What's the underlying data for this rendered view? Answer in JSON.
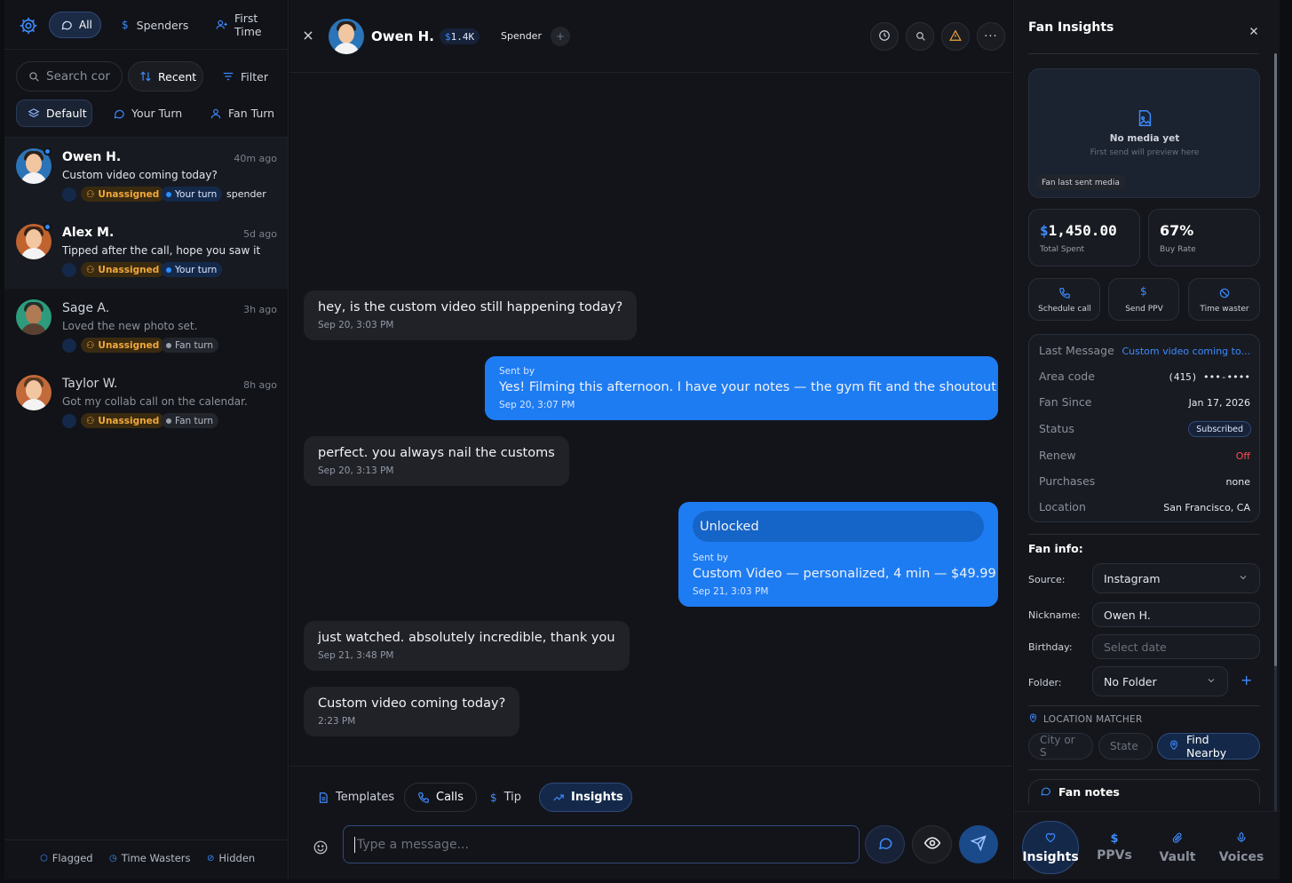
{
  "filters": {
    "all": "All",
    "spenders": "Spenders",
    "first_time": "First Time"
  },
  "search": {
    "placeholder": "Search cor"
  },
  "sort": {
    "recent": "Recent",
    "filter": "Filter"
  },
  "views": {
    "default": "Default",
    "your_turn": "Your Turn",
    "fan_turn": "Fan Turn"
  },
  "conversations": [
    {
      "name": "Owen H.",
      "time": "40m ago",
      "preview": "Custom video coming today?",
      "assign": "Unassigned",
      "turn": "Your turn",
      "extra": "spender"
    },
    {
      "name": "Alex M.",
      "time": "5d ago",
      "preview": "Tipped after the call, hope you saw it",
      "assign": "Unassigned",
      "turn": "Your turn"
    },
    {
      "name": "Sage A.",
      "time": "3h ago",
      "preview": "Loved the new photo set.",
      "assign": "Unassigned",
      "turn": "Fan turn"
    },
    {
      "name": "Taylor W.",
      "time": "8h ago",
      "preview": "Got my collab call on the calendar.",
      "assign": "Unassigned",
      "turn": "Fan turn"
    }
  ],
  "left_footer": {
    "flagged": "Flagged",
    "time_wasters": "Time Wasters",
    "hidden": "Hidden"
  },
  "chat_header": {
    "name": "Owen H.",
    "spent_badge": "1.4K",
    "currency": "$",
    "tag": "Spender",
    "add": "+"
  },
  "messages": [
    {
      "dir": "in",
      "text": "hey, is the custom video still happening today?",
      "time": "Sep 20, 3:03 PM"
    },
    {
      "dir": "out",
      "sent_by": "Sent by",
      "text": "Yes! Filming this afternoon. I have your notes — the gym fit and the shoutout",
      "time": "Sep 20, 3:07 PM"
    },
    {
      "dir": "in",
      "text": "perfect. you always nail the customs",
      "time": "Sep 20, 3:13 PM"
    },
    {
      "dir": "out",
      "unlocked": "Unlocked",
      "sent_by": "Sent by",
      "text": "Custom Video — personalized, 4 min — $49.99",
      "time": "Sep 21, 3:03 PM"
    },
    {
      "dir": "in",
      "text": "just watched. absolutely incredible, thank you",
      "time": "Sep 21, 3:48 PM"
    },
    {
      "dir": "in",
      "text": "Custom video coming today?",
      "time": "2:23 PM"
    }
  ],
  "composer": {
    "templates": "Templates",
    "calls": "Calls",
    "tip": "Tip",
    "tip_symbol": "$",
    "insights": "Insights",
    "placeholder": "Type a message..."
  },
  "insights": {
    "title": "Fan Insights",
    "media": {
      "empty": "No media yet",
      "hint": "First send will preview here",
      "label": "Fan last sent media"
    },
    "total_spent": "1,450.00",
    "total_spent_currency": "$",
    "total_spent_label": "Total Spent",
    "buy_rate": "67%",
    "buy_rate_label": "Buy Rate",
    "actions": {
      "schedule_call": "Schedule call",
      "send_ppv": "Send PPV",
      "time_waster": "Time waster"
    },
    "details": [
      {
        "label": "Last Message",
        "value": "Custom video coming to..."
      },
      {
        "label": "Area code",
        "value": "(415) •••-••••"
      },
      {
        "label": "Fan Since",
        "value": "Jan 17, 2026"
      },
      {
        "label": "Status",
        "value": "Subscribed"
      },
      {
        "label": "Renew",
        "value": "Off"
      },
      {
        "label": "Purchases",
        "value": "none"
      },
      {
        "label": "Location",
        "value": "San Francisco, CA"
      }
    ],
    "fan_info": {
      "title": "Fan info:",
      "source_label": "Source:",
      "source": "Instagram",
      "nickname_label": "Nickname:",
      "nickname": "Owen H.",
      "birthday_label": "Birthday:",
      "birthday_placeholder": "Select date",
      "folder_label": "Folder:",
      "folder": "No Folder",
      "folder_add": "+"
    },
    "location_matcher": {
      "title": "LOCATION MATCHER",
      "city_placeholder": "City or S",
      "state_placeholder": "State",
      "find": "Find Nearby"
    },
    "fan_notes": "Fan notes"
  },
  "bottom_nav": {
    "insights": "Insights",
    "ppvs": "PPVs",
    "vault": "Vault",
    "voices": "Voices"
  },
  "colors": {
    "accent": "#1e7cf2",
    "warning": "#f0a93b",
    "danger": "#ff4d4f"
  }
}
